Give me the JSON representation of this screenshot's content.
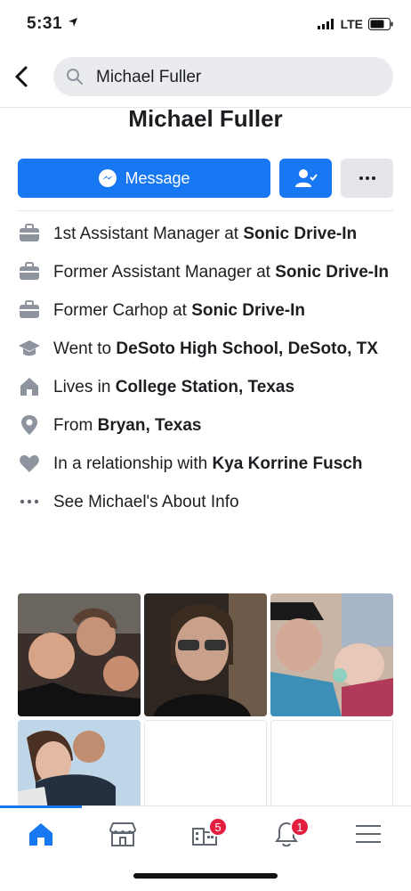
{
  "status_bar": {
    "time": "5:31",
    "network": "LTE"
  },
  "search": {
    "query": "Michael Fuller"
  },
  "profile": {
    "name": "Michael Fuller"
  },
  "actions": {
    "message_label": "Message"
  },
  "info": [
    {
      "icon": "briefcase-icon",
      "prefix": "1st Assistant Manager at ",
      "bold": "Sonic Drive-In"
    },
    {
      "icon": "briefcase-icon",
      "prefix": "Former Assistant Manager at ",
      "bold": "Sonic Drive-In"
    },
    {
      "icon": "briefcase-icon",
      "prefix": "Former Carhop at ",
      "bold": "Sonic Drive-In"
    },
    {
      "icon": "graduation-cap-icon",
      "prefix": "Went to ",
      "bold": "DeSoto High School, DeSoto, TX"
    },
    {
      "icon": "home-icon",
      "prefix": "Lives in ",
      "bold": "College Station, Texas"
    },
    {
      "icon": "location-pin-icon",
      "prefix": "From ",
      "bold": "Bryan, Texas"
    },
    {
      "icon": "heart-icon",
      "prefix": "In a relationship with ",
      "bold": "Kya Korrine Fusch"
    },
    {
      "icon": "more-dots-icon",
      "prefix": "See Michael's About Info",
      "bold": ""
    }
  ],
  "tabs": [
    {
      "name": "home",
      "badge": ""
    },
    {
      "name": "marketplace",
      "badge": ""
    },
    {
      "name": "pages",
      "badge": "5"
    },
    {
      "name": "notifications",
      "badge": "1"
    },
    {
      "name": "menu",
      "badge": ""
    }
  ],
  "colors": {
    "accent": "#1877f2",
    "badge": "#e41e3f",
    "icon_gray": "#8d949e"
  }
}
